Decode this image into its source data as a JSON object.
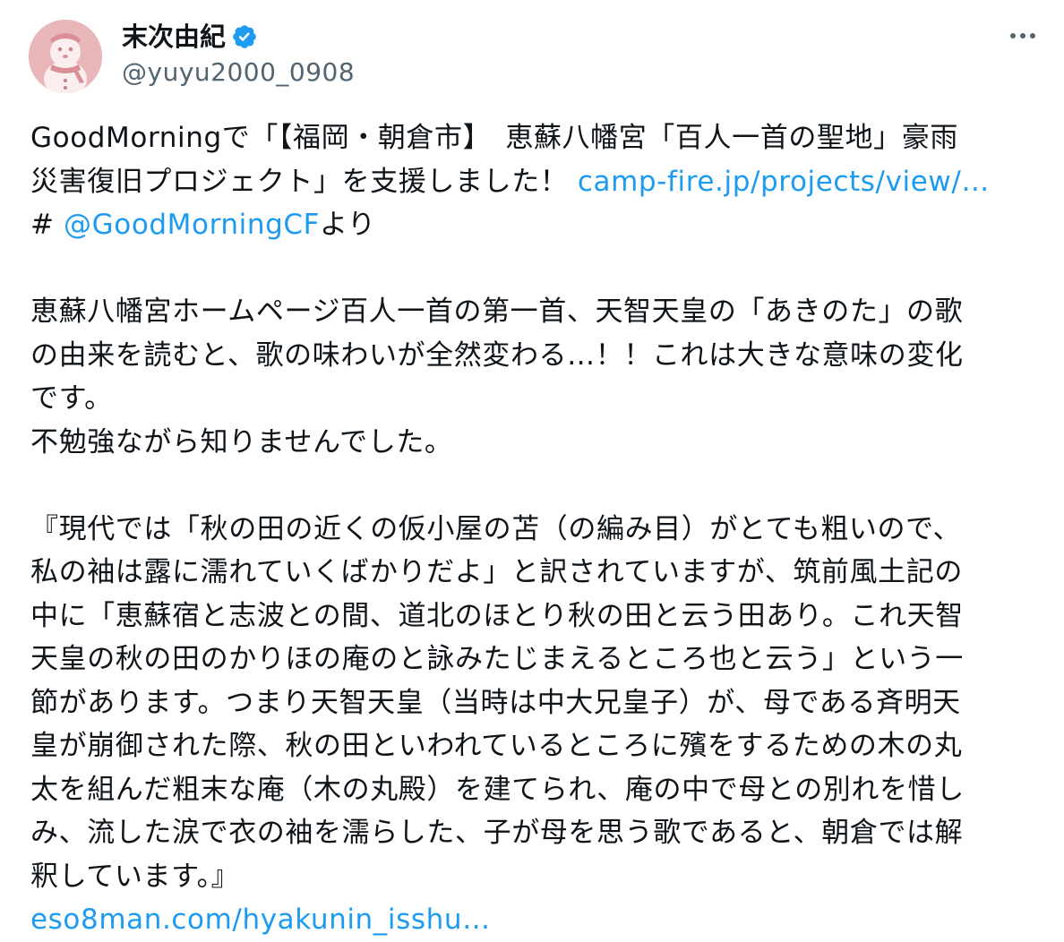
{
  "author": {
    "display_name": "末次由紀",
    "handle": "@yuyu2000_0908",
    "verified": true,
    "avatar_icon": "snowman-avatar"
  },
  "colors": {
    "link": "#1d9bf0",
    "verified_badge": "#1d9bf0",
    "avatar_bg": "#e9b6b9",
    "secondary_text": "#536471"
  },
  "tweet": {
    "para1": {
      "l1": "GoodMorningで「【福岡・朝倉市】　恵蘇八幡宮「百人一首の聖地」豪雨",
      "l2_text": "災害復旧プロジェクト」を支援しました！ ",
      "l2_link": "camp-fire.jp/projects/view/…",
      "l3_hash": "# ",
      "l3_mention": "@GoodMorningCF",
      "l3_tail": "より"
    },
    "para2": [
      "恵蘇八幡宮ホームページ百人一首の第一首、天智天皇の「あきのた」の歌",
      "の由来を読むと、歌の味わいが全然変わる…！！これは大きな意味の変化",
      "です。",
      "不勉強ながら知りませんでした。"
    ],
    "para3": [
      "『現代では「秋の田の近くの仮小屋の苫（の編み目）がとても粗いので、",
      "私の袖は露に濡れていくばかりだよ」と訳されていますが、筑前風土記の",
      "中に「恵蘇宿と志波との間、道北のほとり秋の田と云う田あり。これ天智",
      "天皇の秋の田のかりほの庵のと詠みたじまえるところ也と云う」という一",
      "節があります。つまり天智天皇（当時は中大兄皇子）が、母である斉明天",
      "皇が崩御された際、秋の田といわれているところに殯をするための木の丸",
      "太を組んだ粗末な庵（木の丸殿）を建てられ、庵の中で母との別れを惜し",
      "み、流した涙で衣の袖を濡らした、子が母を思う歌であると、朝倉では解",
      "釈しています。』"
    ],
    "final_link": "eso8man.com/hyakunin_isshu…"
  }
}
